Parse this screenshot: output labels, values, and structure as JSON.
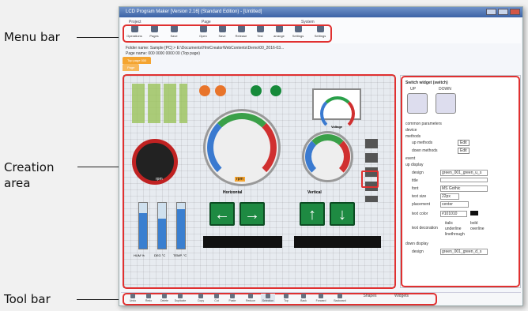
{
  "callouts": {
    "menu_bar": "Menu bar",
    "creation_area": "Creation\narea",
    "tool_bar": "Tool bar"
  },
  "window": {
    "title": "LCD Program Maker [Version 2.16] (Standard Edition) - [Untitled]"
  },
  "menu": {
    "groups": [
      "Project",
      "Page",
      "System"
    ],
    "items": [
      "Operations",
      "Pages",
      "Save",
      "Open",
      "Save",
      "Release",
      "Test",
      "arrange",
      "Settings",
      "Settings"
    ]
  },
  "info": {
    "folder_label": "Folder name",
    "folder_value": ": Sample [PC] > E:\\Documents\\HmiCreatorWebContents\\Demo\\00_2016-03...",
    "page_label": "Page name",
    "page_value": ": 000 0000 0000 00 (Top page)"
  },
  "tabs": [
    "Top page 000",
    "Page"
  ],
  "canvas": {
    "widget_labels": {
      "rpm_left": "rpm",
      "rpm_right": "rpm",
      "voltage": "Voltage",
      "horizontal": "Horizontal",
      "vertical": "Vertical"
    },
    "tank_labels": [
      "HUM %",
      "DEG °C",
      "TEMP. °C"
    ]
  },
  "side": {
    "title": "Switch widget (switch)",
    "up": "UP",
    "down": "DOWN",
    "sections": [
      "common parameters",
      "device",
      "methods",
      "event",
      "up display",
      "down display"
    ],
    "up_method": "up methods",
    "down_method": "down methods",
    "edit": "Edit",
    "design_label": "design",
    "design_value": "green_001_green_u_s",
    "title_label": "title",
    "font_label": "font",
    "font_value": "MS Gothic",
    "size_label": "text size",
    "size_value": "22px",
    "placement_label": "placement",
    "placement_value": "center",
    "color_label": "text color",
    "color_value": "#101010",
    "deco_label": "text decoration",
    "deco_opts": [
      "italic",
      "bold",
      "underline",
      "overline",
      "linethrough"
    ],
    "down_design_label": "design",
    "down_design_value": "green_001_green_d_s"
  },
  "toolbar": {
    "items": [
      "Undo",
      "Redo",
      "Delete",
      "Duplicate",
      "Copy",
      "Cut",
      "Paste",
      "Reduce",
      "Selection",
      "Top",
      "Back",
      "Forward",
      "Backward"
    ],
    "shapes": "Shapes",
    "widgets": "Widgets"
  }
}
